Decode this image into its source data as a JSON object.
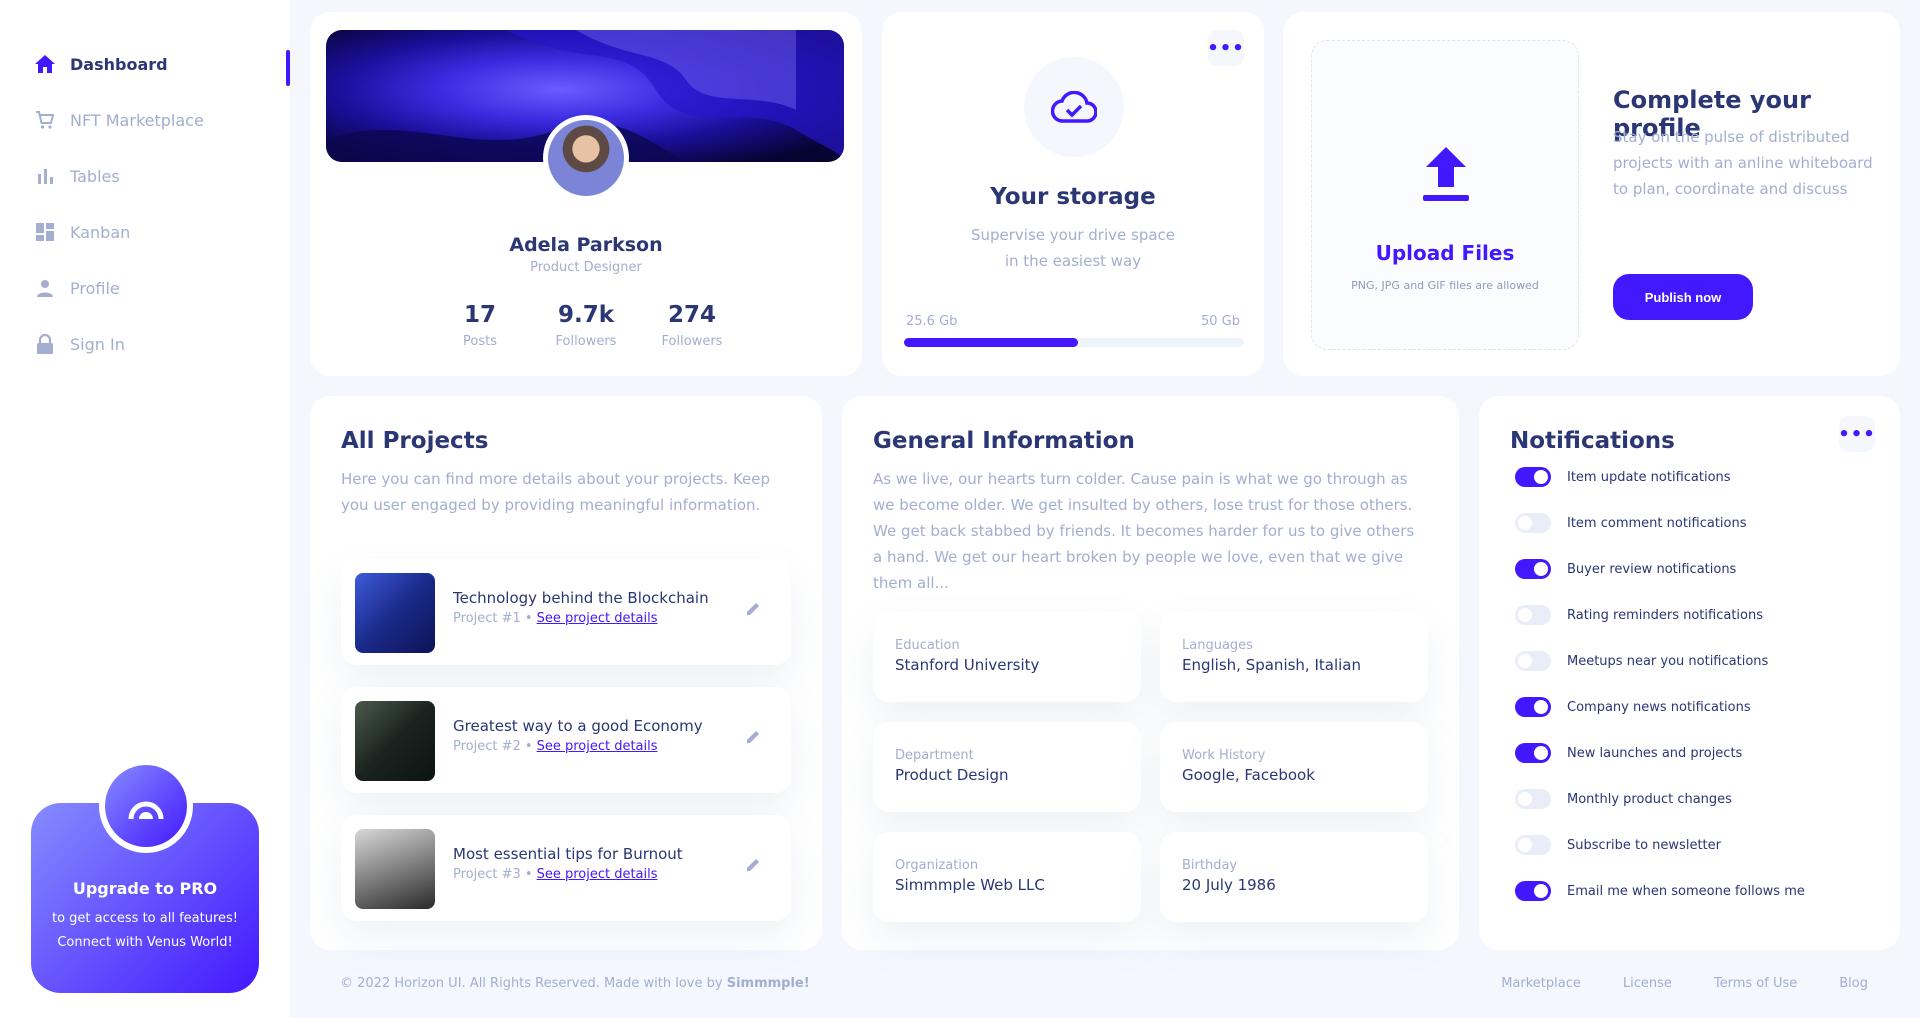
{
  "sidebar": {
    "items": [
      {
        "label": "Dashboard",
        "icon": "home-icon",
        "active": true
      },
      {
        "label": "NFT Marketplace",
        "icon": "cart-icon",
        "active": false
      },
      {
        "label": "Tables",
        "icon": "bar-chart-icon",
        "active": false
      },
      {
        "label": "Kanban",
        "icon": "dashboard-grid-icon",
        "active": false
      },
      {
        "label": "Profile",
        "icon": "person-icon",
        "active": false
      },
      {
        "label": "Sign In",
        "icon": "lock-icon",
        "active": false
      }
    ],
    "upgrade": {
      "title": "Upgrade to PRO",
      "line1": "to get access to all features!",
      "line2": "Connect with Venus World!"
    }
  },
  "profile": {
    "name": "Adela Parkson",
    "role": "Product Designer",
    "stats": [
      {
        "value": "17",
        "label": "Posts"
      },
      {
        "value": "9.7k",
        "label": "Followers"
      },
      {
        "value": "274",
        "label": "Followers"
      }
    ]
  },
  "storage": {
    "title": "Your storage",
    "desc_line1": "Supervise your drive space",
    "desc_line2": "in the easiest way",
    "used": "25.6 Gb",
    "total": "50 Gb",
    "progress_fraction": 0.512
  },
  "upload": {
    "title": "Upload Files",
    "subtitle": "PNG, JPG and GIF files are allowed",
    "cp_title": "Complete your profile",
    "cp_desc": "Stay on the pulse of distributed projects with an anline whiteboard to plan, coordinate and discuss",
    "button": "Publish now"
  },
  "projects": {
    "title": "All Projects",
    "desc": "Here you can find more details about your projects. Keep you user engaged by providing meaningful information.",
    "link_label": "See project details",
    "items": [
      {
        "title": "Technology behind the Blockchain",
        "meta": "Project #1 •"
      },
      {
        "title": "Greatest way to a good Economy",
        "meta": "Project #2 •"
      },
      {
        "title": "Most essential tips for Burnout",
        "meta": "Project #3 •"
      }
    ]
  },
  "general": {
    "title": "General Information",
    "desc": "As we live, our hearts turn colder. Cause pain is what we go through as we become older. We get insulted by others, lose trust for those others. We get back stabbed by friends. It becomes harder for us to give others a hand. We get our heart broken by people we love, even that we give them all...",
    "fields": [
      {
        "label": "Education",
        "value": "Stanford University"
      },
      {
        "label": "Languages",
        "value": "English, Spanish, Italian"
      },
      {
        "label": "Department",
        "value": "Product Design"
      },
      {
        "label": "Work History",
        "value": "Google, Facebook"
      },
      {
        "label": "Organization",
        "value": "Simmmple Web LLC"
      },
      {
        "label": "Birthday",
        "value": "20 July 1986"
      }
    ]
  },
  "notifications": {
    "title": "Notifications",
    "items": [
      {
        "label": "Item update notifications",
        "on": true
      },
      {
        "label": "Item comment notifications",
        "on": false
      },
      {
        "label": "Buyer review notifications",
        "on": true
      },
      {
        "label": "Rating reminders notifications",
        "on": false
      },
      {
        "label": "Meetups near you notifications",
        "on": false
      },
      {
        "label": "Company news notifications",
        "on": true
      },
      {
        "label": "New launches and projects",
        "on": true
      },
      {
        "label": "Monthly product changes",
        "on": false
      },
      {
        "label": "Subscribe to newsletter",
        "on": false
      },
      {
        "label": "Email me when someone follows me",
        "on": true
      }
    ]
  },
  "footer": {
    "copyright": "© 2022 Horizon UI. All Rights Reserved. Made with love by",
    "brand": "Simmmple!",
    "links": [
      "Marketplace",
      "License",
      "Terms of Use",
      "Blog"
    ]
  },
  "colors": {
    "accent": "#4318ff",
    "text": "#2b3674",
    "muted": "#a3aed0",
    "background": "#f4f7fe"
  }
}
